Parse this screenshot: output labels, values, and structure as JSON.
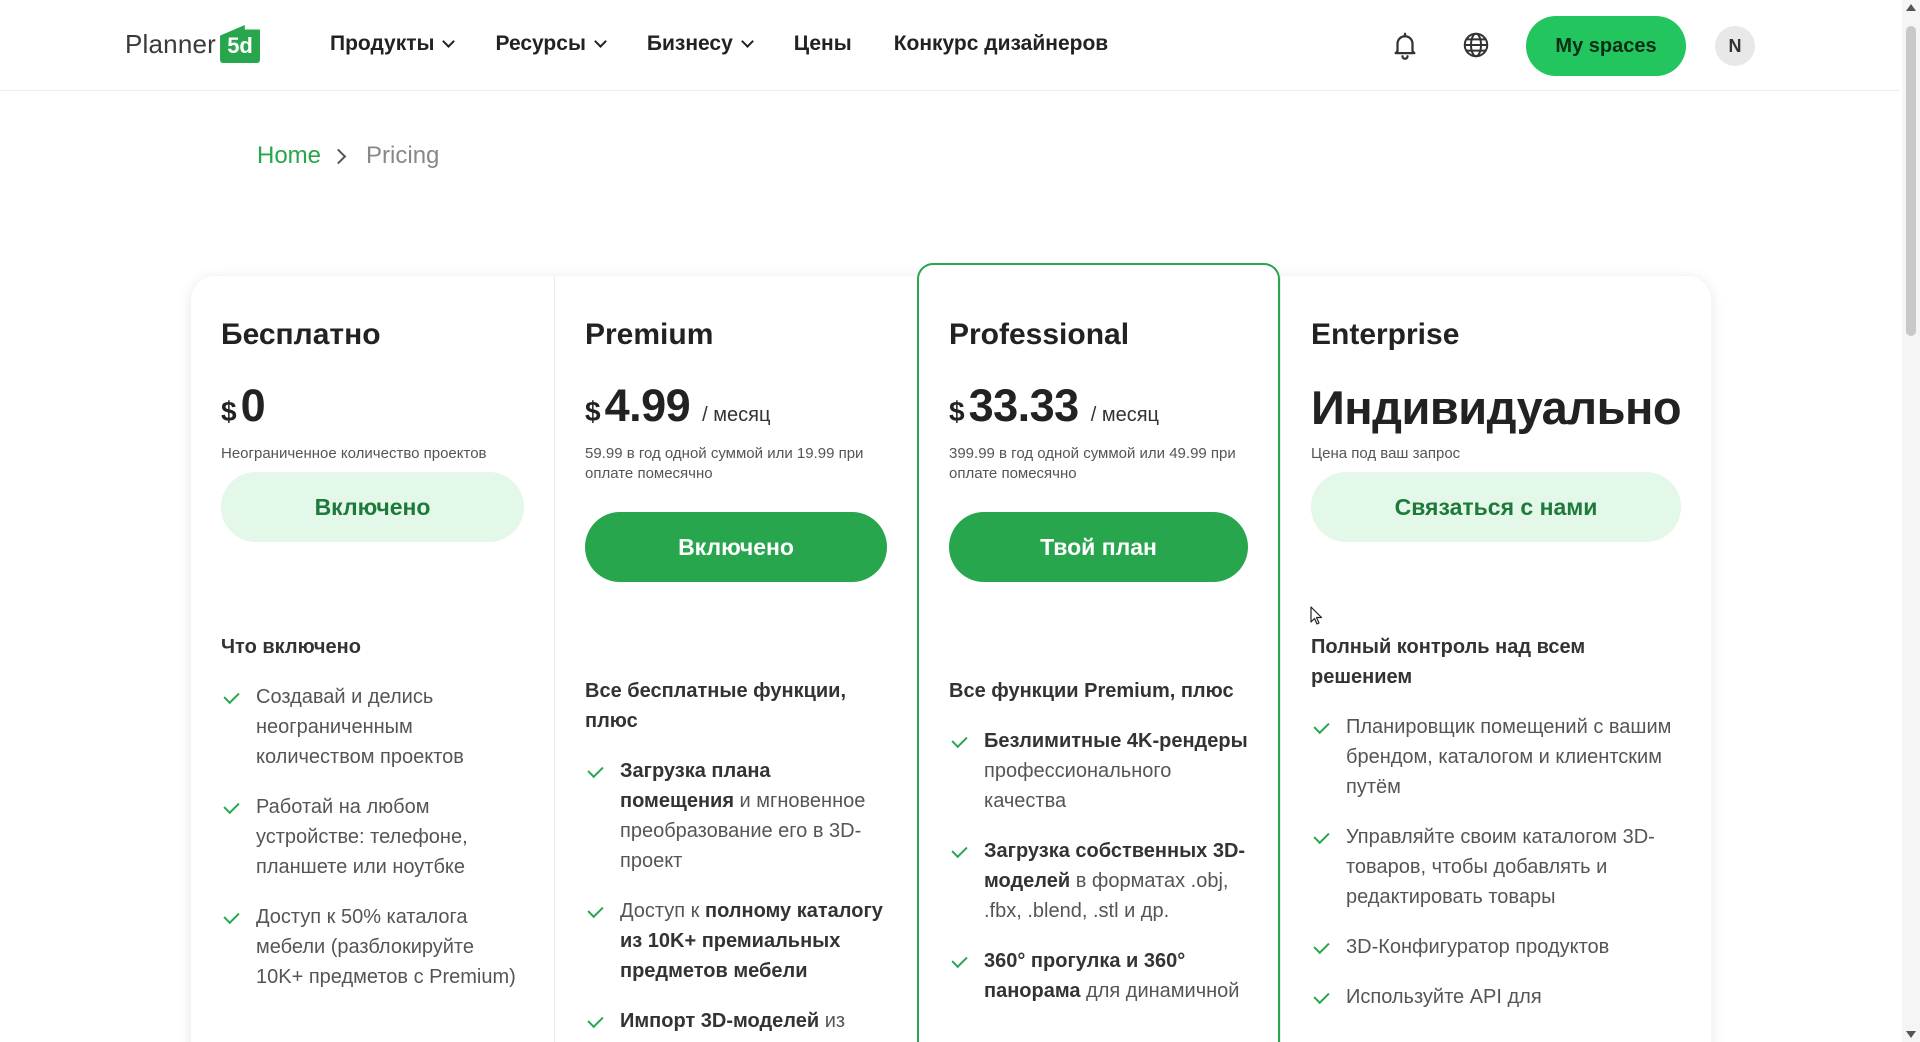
{
  "header": {
    "logo_text": "Planner",
    "logo_badge": "5d",
    "nav": [
      {
        "label": "Продукты",
        "has_dropdown": true
      },
      {
        "label": "Ресурсы",
        "has_dropdown": true
      },
      {
        "label": "Бизнесу",
        "has_dropdown": true
      },
      {
        "label": "Цены",
        "has_dropdown": false
      },
      {
        "label": "Конкурс дизайнеров",
        "has_dropdown": false
      }
    ],
    "icons": [
      "bell-icon",
      "globe-icon"
    ],
    "my_spaces_label": "My spaces",
    "avatar_initial": "N"
  },
  "breadcrumb": {
    "home": "Home",
    "current": "Pricing"
  },
  "plans": [
    {
      "name": "Бесплатно",
      "currency": "$",
      "amount": "0",
      "period": "",
      "note": "Неограниченное количество проектов",
      "cta": "Включено",
      "features_heading": "Что включено",
      "features": [
        {
          "bold": "",
          "text": "Создавай и делись неограниченным количеством проектов"
        },
        {
          "bold": "",
          "text": "Работай на любом устройстве: телефоне, планшете или ноутбке"
        },
        {
          "bold": "",
          "text": "Доступ к 50% каталога мебели (разблокируйте 10K+ предметов с Premium)"
        }
      ]
    },
    {
      "name": "Premium",
      "currency": "$",
      "amount": "4.99",
      "period": "/ месяц",
      "note": "59.99 в год одной суммой или 19.99 при оплате помесячно",
      "cta": "Включено",
      "features_heading": "Все бесплатные функции, плюс",
      "features": [
        {
          "bold": "Загрузка плана помещения",
          "text": " и мгновенное преобразование его в 3D-проект"
        },
        {
          "bold": "",
          "text": "Доступ к ",
          "bold_after": "полному каталогу из 10K+ премиальных предметов мебели"
        },
        {
          "bold": "Импорт 3D-моделей",
          "text": " из"
        }
      ]
    },
    {
      "name": "Professional",
      "currency": "$",
      "amount": "33.33",
      "period": "/ месяц",
      "note": "399.99 в год одной суммой или 49.99 при оплате помесячно",
      "cta": "Твой план",
      "features_heading": "Все функции Premium, плюс",
      "features": [
        {
          "bold": "Безлимитные 4K-рендеры",
          "text": " профессионального качества"
        },
        {
          "bold": "Загрузка собственных 3D-моделей",
          "text": " в форматах .obj, .fbx, .blend, .stl и др."
        },
        {
          "bold": "360° прогулка и 360° панорама",
          "text": " для динамичной"
        }
      ]
    },
    {
      "name": "Enterprise",
      "currency": "",
      "amount": "Индивидуально",
      "period": "",
      "note": "Цена под ваш запрос",
      "cta": "Связаться с нами",
      "features_heading": "Полный контроль над всем решением",
      "features": [
        {
          "bold": "",
          "text": "Планировщик помещений с вашим брендом, каталогом и клиентским путём"
        },
        {
          "bold": "",
          "text": "Управляйте своим каталогом 3D-товаров, чтобы добавлять и редактировать товары"
        },
        {
          "bold": "",
          "text": "3D-Конфигуратор продуктов"
        },
        {
          "bold": "",
          "text": "Используйте API для"
        }
      ]
    }
  ],
  "colors": {
    "brand_green": "#27a64e",
    "bright_green": "#22c55e",
    "light_green": "#e3f8e8"
  }
}
